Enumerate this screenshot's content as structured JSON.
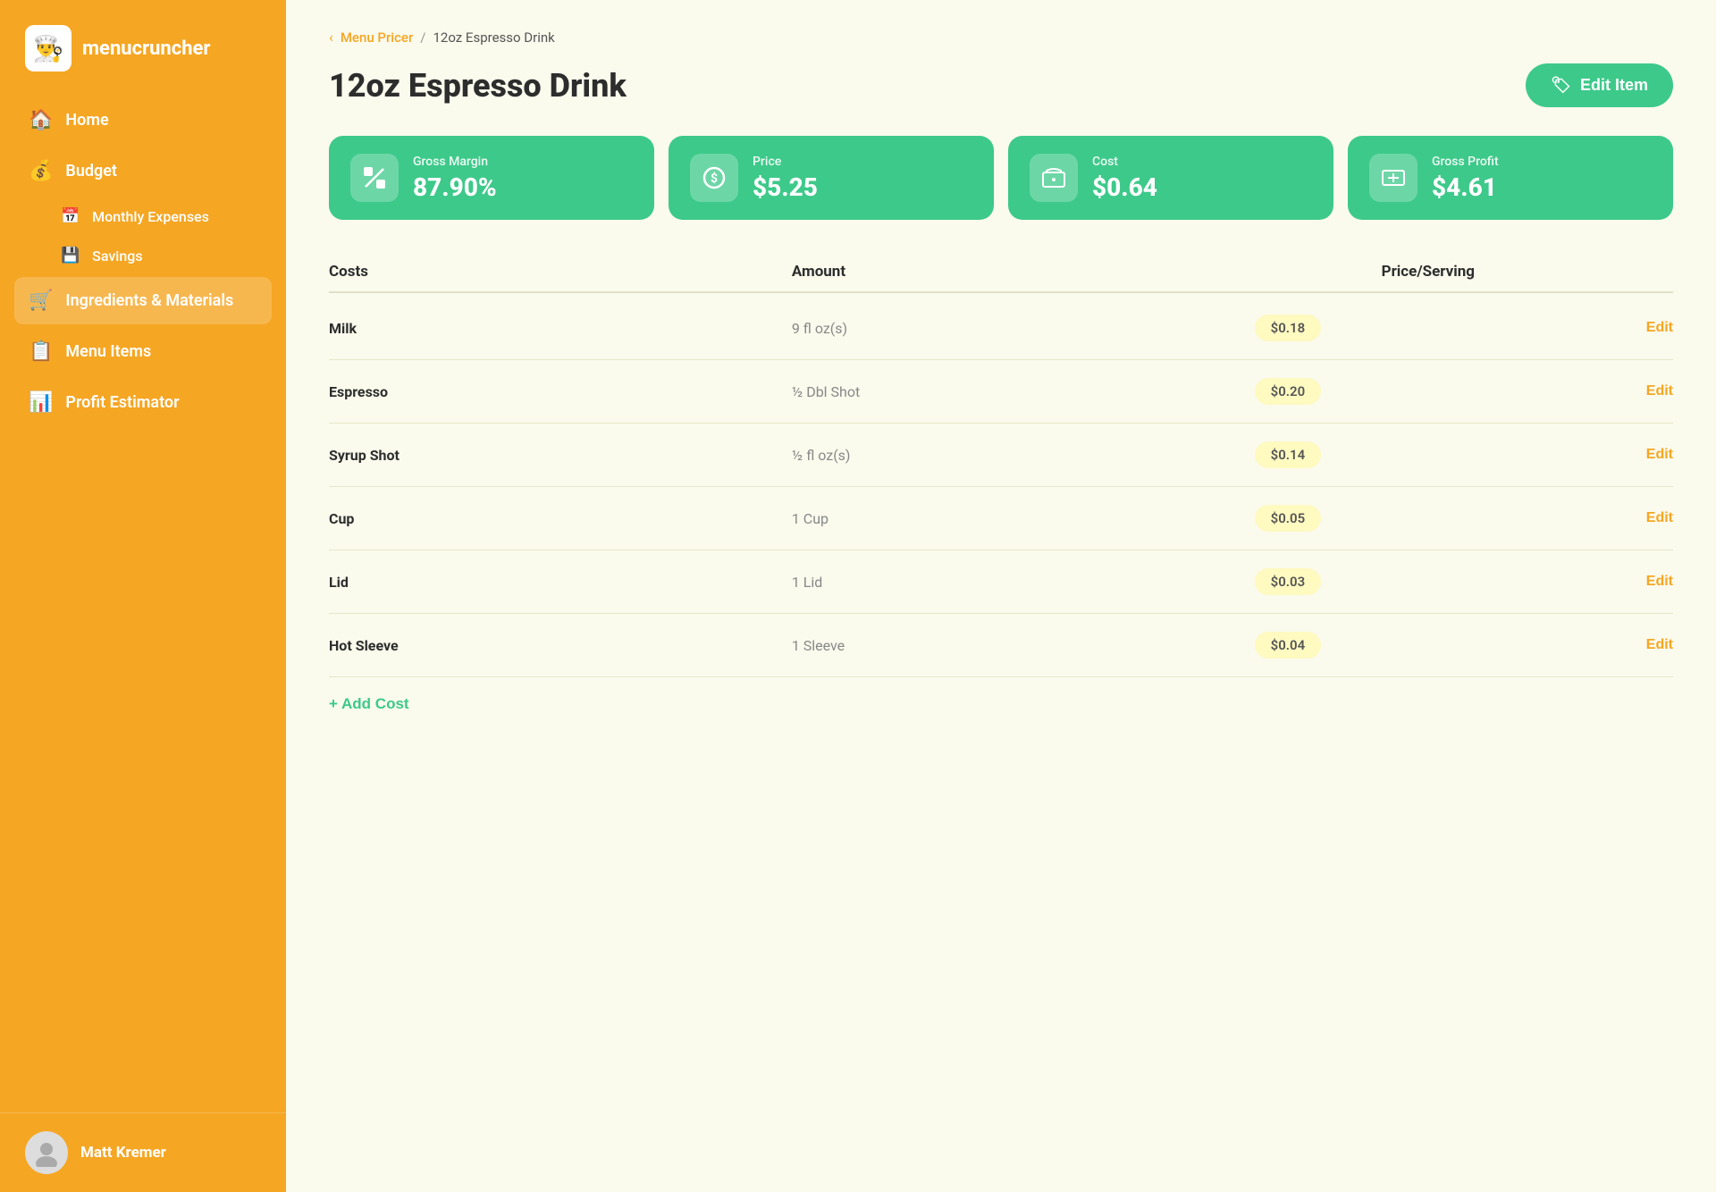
{
  "sidebar": {
    "logo_text": "menucruncher",
    "logo_icon": "👨‍🍳",
    "nav_items": [
      {
        "id": "home",
        "label": "Home",
        "icon": "🏠"
      },
      {
        "id": "budget",
        "label": "Budget",
        "icon": "💰",
        "sub_items": [
          {
            "id": "monthly-expenses",
            "label": "Monthly Expenses",
            "icon": "📅"
          },
          {
            "id": "savings",
            "label": "Savings",
            "icon": "💾"
          }
        ]
      },
      {
        "id": "ingredients",
        "label": "Ingredients & Materials",
        "icon": "🛒"
      },
      {
        "id": "menu-items",
        "label": "Menu Items",
        "icon": "📋"
      },
      {
        "id": "profit-estimator",
        "label": "Profit Estimator",
        "icon": "📊"
      }
    ],
    "user_name": "Matt Kremer"
  },
  "breadcrumb": {
    "parent_label": "Menu Pricer",
    "separator": "/",
    "current_label": "12oz Espresso Drink",
    "arrow": "‹"
  },
  "page": {
    "title": "12oz Espresso Drink",
    "edit_button_label": "Edit Item",
    "edit_button_icon": "🏷"
  },
  "stats": [
    {
      "id": "gross-margin",
      "label": "Gross Margin",
      "value": "87.90%",
      "icon": "%"
    },
    {
      "id": "price",
      "label": "Price",
      "value": "$5.25",
      "icon": "$"
    },
    {
      "id": "cost",
      "label": "Cost",
      "value": "$0.64",
      "icon": "🛒"
    },
    {
      "id": "gross-profit",
      "label": "Gross Profit",
      "value": "$4.61",
      "icon": "💵"
    }
  ],
  "table": {
    "columns": [
      {
        "id": "costs",
        "label": "Costs"
      },
      {
        "id": "amount",
        "label": "Amount"
      },
      {
        "id": "price-per-serving",
        "label": "Price/Serving"
      },
      {
        "id": "actions",
        "label": ""
      }
    ],
    "rows": [
      {
        "name": "Milk",
        "amount": "9 fl oz(s)",
        "price": "$0.18"
      },
      {
        "name": "Espresso",
        "amount": "½ Dbl Shot",
        "price": "$0.20"
      },
      {
        "name": "Syrup Shot",
        "amount": "½ fl oz(s)",
        "price": "$0.14"
      },
      {
        "name": "Cup",
        "amount": "1 Cup",
        "price": "$0.05"
      },
      {
        "name": "Lid",
        "amount": "1 Lid",
        "price": "$0.03"
      },
      {
        "name": "Hot Sleeve",
        "amount": "1 Sleeve",
        "price": "$0.04"
      }
    ],
    "edit_label": "Edit",
    "add_cost_label": "+ Add Cost"
  },
  "colors": {
    "orange": "#F5A623",
    "green": "#3DC98A",
    "bg": "#FAFAED",
    "badge_bg": "#FEFAC0"
  }
}
